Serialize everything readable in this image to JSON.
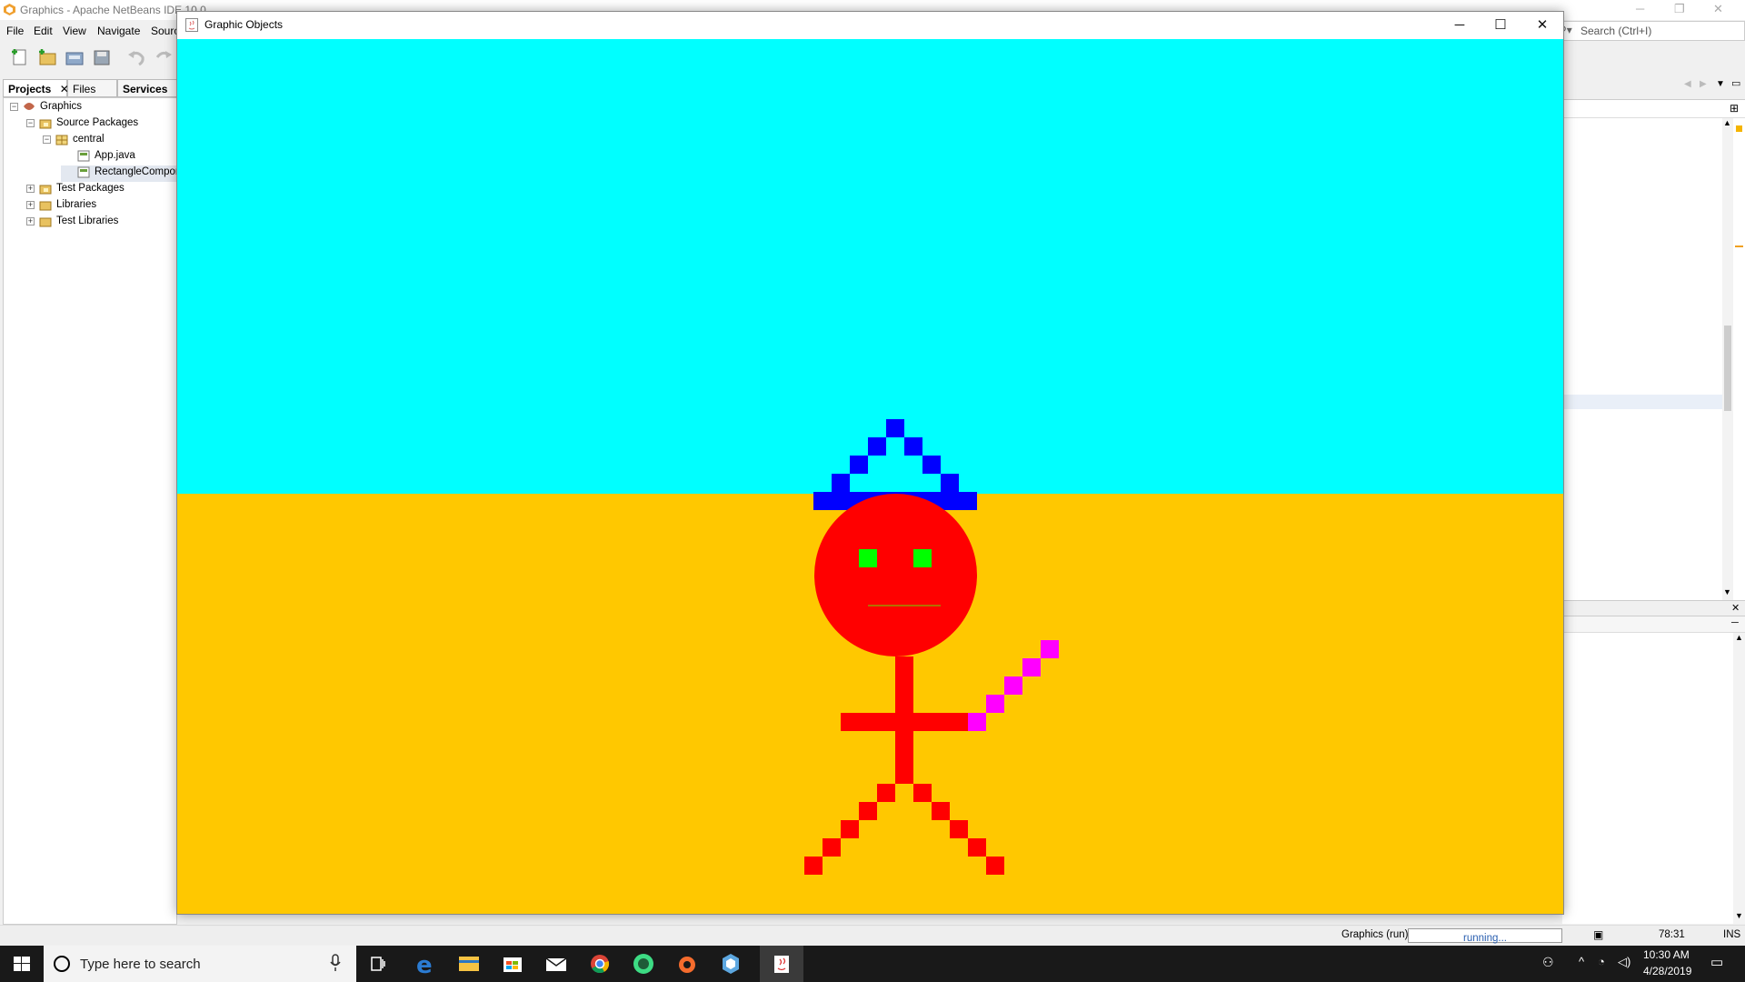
{
  "ide": {
    "title": "Graphics - Apache NetBeans IDE 10.0",
    "menu": [
      "File",
      "Edit",
      "View",
      "Navigate",
      "Sourc"
    ],
    "search_placeholder": "Search (Ctrl+I)",
    "project_tabs": [
      "Projects",
      "Files",
      "Services"
    ],
    "tree": [
      {
        "label": "Graphics",
        "icon": "project-icon"
      },
      {
        "label": "Source Packages",
        "icon": "package-folder-icon"
      },
      {
        "label": "central",
        "icon": "package-icon"
      },
      {
        "label": "App.java",
        "icon": "java-file-icon"
      },
      {
        "label": "RectangleCompone",
        "icon": "java-file-icon"
      },
      {
        "label": "Test Packages",
        "icon": "package-folder-icon"
      },
      {
        "label": "Libraries",
        "icon": "library-icon"
      },
      {
        "label": "Test Libraries",
        "icon": "library-icon"
      }
    ],
    "status": {
      "task": "Graphics (run)",
      "progress_label": "running...",
      "position": "78:31",
      "mode": "INS"
    }
  },
  "java_window": {
    "title": "Graphic Objects",
    "controls": {
      "minimize": "─",
      "maximize": "☐",
      "close": "✕"
    }
  },
  "scene": {
    "sky_color": "#00ffff",
    "ground_color": "#ffc800",
    "hat_color": "#0000ff",
    "body_color": "#ff0000",
    "eye_color": "#00ff00",
    "wand_color": "#ff00ff"
  },
  "taskbar": {
    "search_placeholder": "Type here to search",
    "apps": [
      "task-view-icon",
      "edge-icon",
      "file-explorer-icon",
      "store-icon",
      "mail-icon",
      "chrome-icon",
      "android-studio-icon",
      "origin-icon",
      "netbeans-icon",
      "java-icon"
    ],
    "time": "10:30 AM",
    "date": "4/28/2019"
  }
}
